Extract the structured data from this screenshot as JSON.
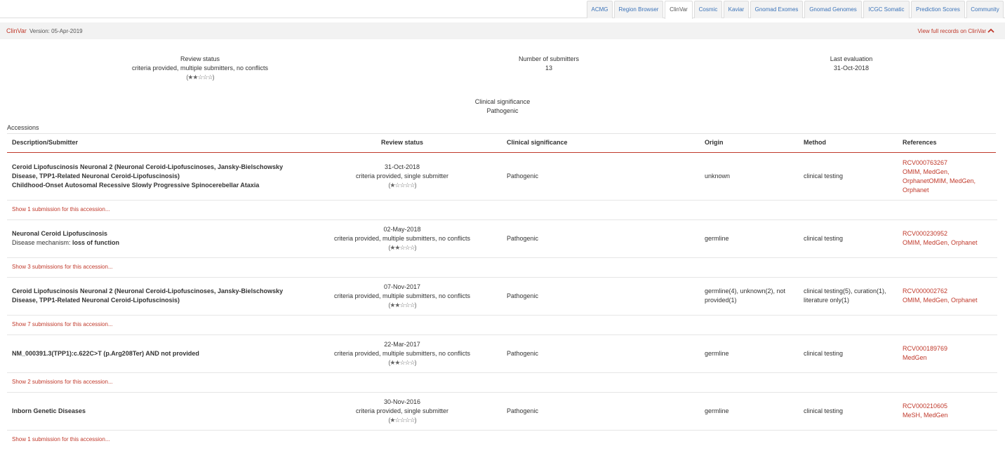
{
  "tabs": [
    {
      "label": "ACMG",
      "active": false
    },
    {
      "label": "Region Browser",
      "active": false
    },
    {
      "label": "ClinVar",
      "active": true
    },
    {
      "label": "Cosmic",
      "active": false
    },
    {
      "label": "Kaviar",
      "active": false
    },
    {
      "label": "Gnomad Exomes",
      "active": false
    },
    {
      "label": "Gnomad Genomes",
      "active": false
    },
    {
      "label": "ICGC Somatic",
      "active": false
    },
    {
      "label": "Prediction Scores",
      "active": false
    },
    {
      "label": "Community",
      "active": false
    }
  ],
  "header": {
    "title": "ClinVar",
    "version": "Version: 05-Apr-2019",
    "full_records_link": "View full records on ClinVar",
    "collapse_icon": "chevron-up-icon"
  },
  "summary": {
    "review_status_label": "Review status",
    "review_status_value": "criteria provided, multiple submitters, no conflicts",
    "review_status_stars": "(★★☆☆☆)",
    "submitters_label": "Number of submitters",
    "submitters_value": "13",
    "last_eval_label": "Last evaluation",
    "last_eval_value": "31-Oct-2018",
    "clin_sig_label": "Clinical significance",
    "clin_sig_value": "Pathogenic"
  },
  "accessions": {
    "title": "Accessions",
    "columns": [
      "Description/Submitter",
      "Review status",
      "Clinical significance",
      "Origin",
      "Method",
      "References"
    ],
    "rows": [
      {
        "desc_line1": "Ceroid Lipofuscinosis Neuronal 2 (Neuronal Ceroid-Lipofuscinoses, Jansky-Bielschowsky",
        "desc_line2": "Disease, TPP1-Related Neuronal Ceroid-Lipofuscinosis)",
        "desc_line3": "Childhood-Onset Autosomal Recessive Slowly Progressive Spinocerebellar Ataxia",
        "date": "31-Oct-2018",
        "review": "criteria provided, single submitter",
        "stars": "(★☆☆☆☆)",
        "significance": "Pathogenic",
        "origin": "unknown",
        "origin2": "",
        "method": "clinical testing",
        "method2": "",
        "ref_line1": "RCV000763267",
        "ref_line2": "OMIM, MedGen,",
        "ref_line3": "OrphanetOMIM, MedGen,",
        "ref_line4": "Orphanet",
        "show_link": "Show 1 submission for this accession..."
      },
      {
        "desc_line1": "Neuronal Ceroid Lipofuscinosis",
        "desc_line2_label": "Disease mechanism: ",
        "desc_line2_value": "loss of function",
        "date": "02-May-2018",
        "review": "criteria provided, multiple submitters, no conflicts",
        "stars": "(★★☆☆☆)",
        "significance": "Pathogenic",
        "origin": "germline",
        "method": "clinical testing",
        "ref_line1": "RCV000230952",
        "ref_line2": "OMIM, MedGen, Orphanet",
        "show_link": "Show 3 submissions for this accession..."
      },
      {
        "desc_line1": "Ceroid Lipofuscinosis Neuronal 2 (Neuronal Ceroid-Lipofuscinoses, Jansky-Bielschowsky",
        "desc_line2": "Disease, TPP1-Related Neuronal Ceroid-Lipofuscinosis)",
        "date": "07-Nov-2017",
        "review": "criteria provided, multiple submitters, no conflicts",
        "stars": "(★★☆☆☆)",
        "significance": "Pathogenic",
        "origin": "germline(4), unknown(2), not",
        "origin2": "provided(1)",
        "method": "clinical testing(5), curation(1),",
        "method2": "literature only(1)",
        "ref_line1": "RCV000002762",
        "ref_line2": "OMIM, MedGen, Orphanet",
        "show_link": "Show 7 submissions for this accession..."
      },
      {
        "desc_line1": "NM_000391.3(TPP1):c.622C>T (p.Arg208Ter) AND not provided",
        "date": "22-Mar-2017",
        "review": "criteria provided, multiple submitters, no conflicts",
        "stars": "(★★☆☆☆)",
        "significance": "Pathogenic",
        "origin": "germline",
        "method": "clinical testing",
        "ref_line1": "RCV000189769",
        "ref_line2": "MedGen",
        "show_link": "Show 2 submissions for this accession..."
      },
      {
        "desc_line1": "Inborn Genetic Diseases",
        "date": "30-Nov-2016",
        "review": "criteria provided, single submitter",
        "stars": "(★☆☆☆☆)",
        "significance": "Pathogenic",
        "origin": "germline",
        "method": "clinical testing",
        "ref_line1": "RCV000210605",
        "ref_line2": "MeSH, MedGen",
        "show_link": "Show 1 submission for this accession..."
      }
    ]
  }
}
